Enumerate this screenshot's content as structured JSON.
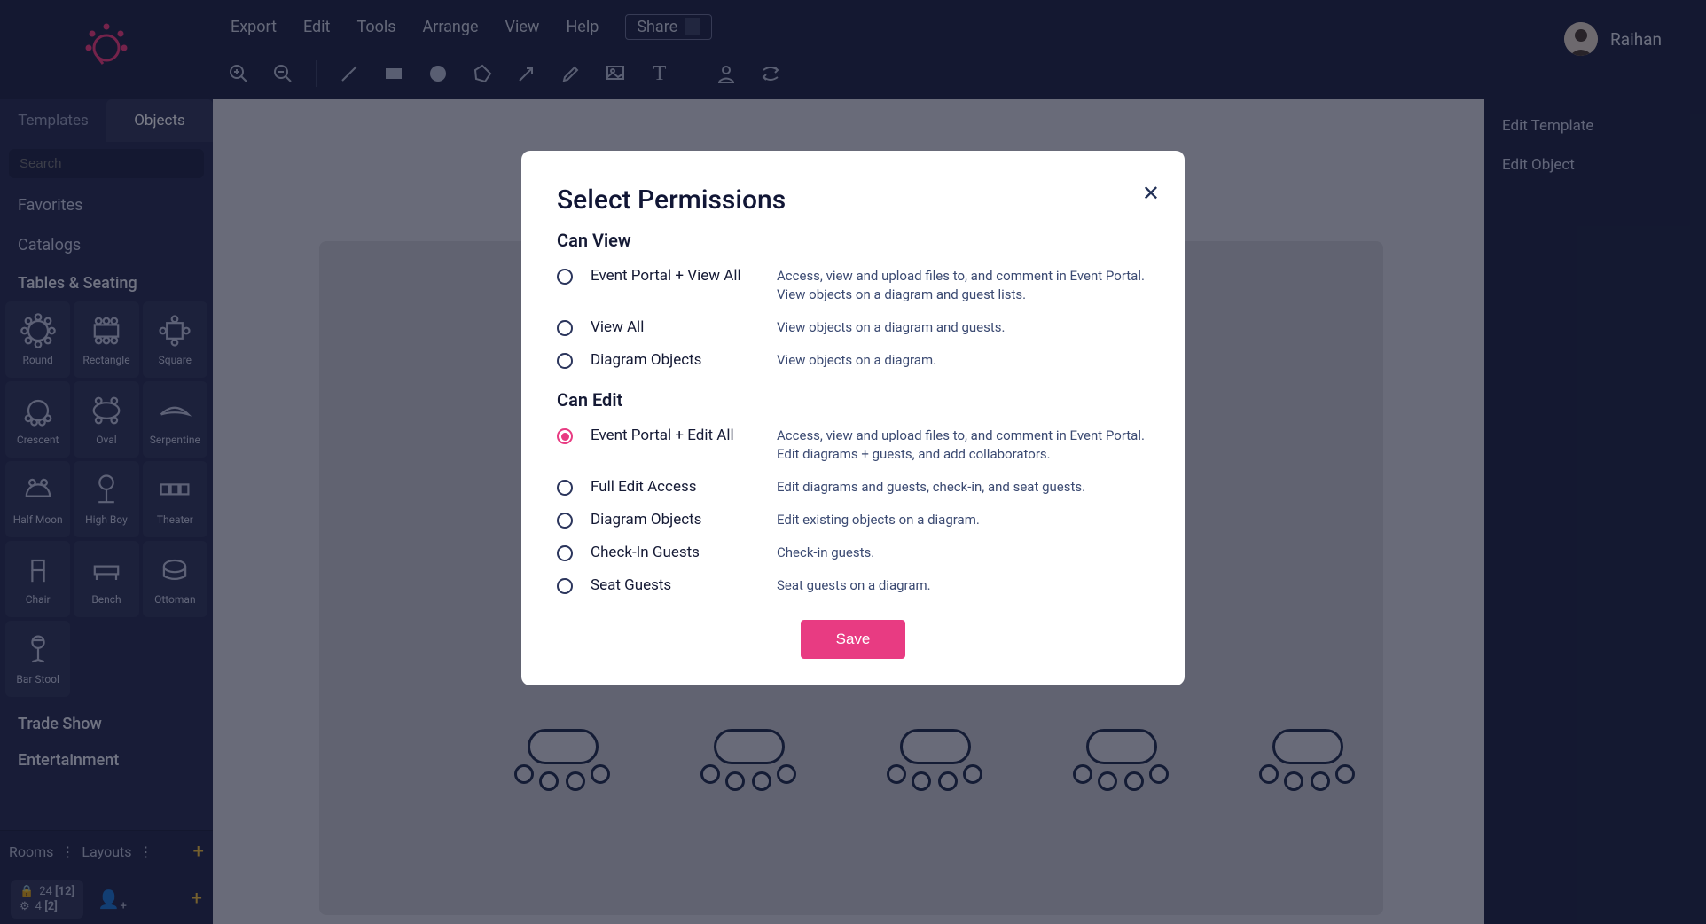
{
  "menu": {
    "export": "Export",
    "edit": "Edit",
    "tools": "Tools",
    "arrange": "Arrange",
    "view": "View",
    "help": "Help",
    "share": "Share"
  },
  "user": {
    "name": "Raihan"
  },
  "sidebar": {
    "tabs": {
      "templates": "Templates",
      "objects": "Objects"
    },
    "search_placeholder": "Search",
    "favorites": "Favorites",
    "catalogs": "Catalogs",
    "section_tables": "Tables & Seating",
    "items": [
      {
        "label": "Round"
      },
      {
        "label": "Rectangle"
      },
      {
        "label": "Square"
      },
      {
        "label": "Crescent"
      },
      {
        "label": "Oval"
      },
      {
        "label": "Serpentine"
      },
      {
        "label": "Half Moon"
      },
      {
        "label": "High Boy"
      },
      {
        "label": "Theater"
      },
      {
        "label": "Chair"
      },
      {
        "label": "Bench"
      },
      {
        "label": "Ottoman"
      },
      {
        "label": "Bar Stool"
      }
    ],
    "section_trade": "Trade Show",
    "section_entertainment": "Entertainment",
    "rooms": "Rooms",
    "layouts": "Layouts",
    "count1a": "24",
    "count1b": "[12]",
    "count2a": "4",
    "count2b": "[2]"
  },
  "right": {
    "edit_template": "Edit Template",
    "edit_object": "Edit Object"
  },
  "modal": {
    "title": "Select Permissions",
    "groups": [
      {
        "heading": "Can View",
        "options": [
          {
            "label": "Event Portal + View All",
            "desc": "Access, view and upload files to, and comment in Event Portal. View objects on a diagram and guest lists.",
            "selected": false
          },
          {
            "label": "View All",
            "desc": "View objects on a diagram and guests.",
            "selected": false
          },
          {
            "label": "Diagram Objects",
            "desc": "View objects on a diagram.",
            "selected": false
          }
        ]
      },
      {
        "heading": "Can Edit",
        "options": [
          {
            "label": "Event Portal + Edit All",
            "desc": "Access, view and upload files to, and comment in Event Portal. Edit diagrams + guests, and add collaborators.",
            "selected": true
          },
          {
            "label": "Full Edit Access",
            "desc": "Edit diagrams and guests, check-in, and seat guests.",
            "selected": false
          },
          {
            "label": "Diagram Objects",
            "desc": "Edit existing objects on a diagram.",
            "selected": false
          },
          {
            "label": "Check-In Guests",
            "desc": "Check-in guests.",
            "selected": false
          },
          {
            "label": "Seat Guests",
            "desc": "Seat guests on a diagram.",
            "selected": false
          }
        ]
      }
    ],
    "save": "Save"
  }
}
